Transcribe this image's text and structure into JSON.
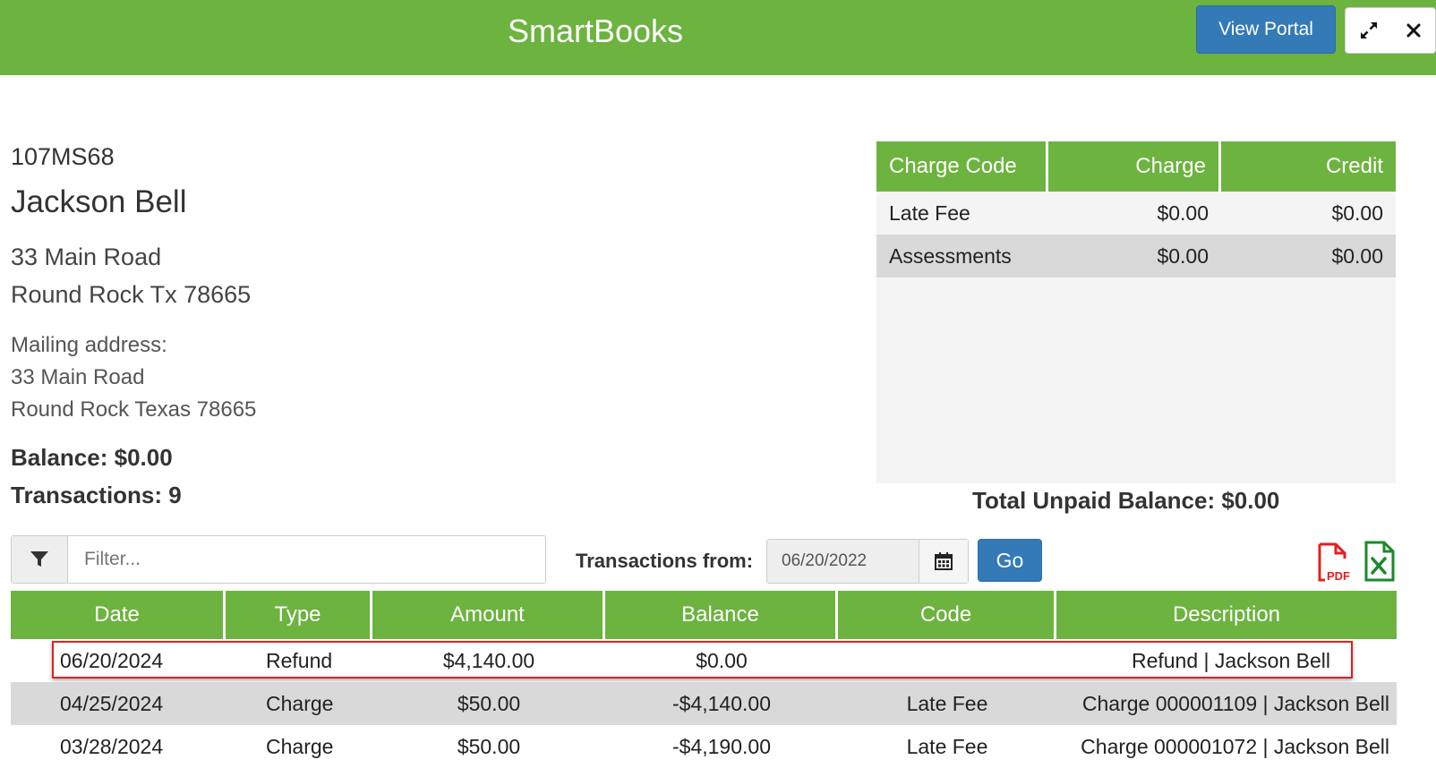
{
  "header": {
    "title": "SmartBooks",
    "view_portal_label": "View Portal",
    "expand_icon": "expand-arrows-icon",
    "close_icon": "close-icon"
  },
  "account": {
    "id": "107MS68",
    "name": "Jackson Bell",
    "address_line1": "33 Main Road",
    "address_line2": "Round Rock Tx 78665",
    "mailing_label": "Mailing address:",
    "mailing_line1": "33 Main Road",
    "mailing_line2": "Round Rock Texas 78665",
    "balance": "Balance: $0.00",
    "transactions": "Transactions: 9"
  },
  "charge_codes": {
    "headers": [
      "Charge Code",
      "Charge",
      "Credit"
    ],
    "rows": [
      {
        "code": "Late Fee",
        "charge": "$0.00",
        "credit": "$0.00"
      },
      {
        "code": "Assessments",
        "charge": "$0.00",
        "credit": "$0.00"
      }
    ],
    "total_unpaid": "Total Unpaid Balance: $0.00"
  },
  "filters": {
    "filter_placeholder": "Filter...",
    "filter_icon": "funnel-icon",
    "transactions_from_label": "Transactions from:",
    "date_value": "06/20/2022",
    "calendar_icon": "calendar-icon",
    "go_label": "Go",
    "pdf_icon": "pdf-export-icon",
    "excel_icon": "excel-export-icon"
  },
  "transactions": {
    "headers": [
      "Date",
      "Type",
      "Amount",
      "Balance",
      "Code",
      "Description"
    ],
    "rows": [
      {
        "date": "06/20/2024",
        "type": "Refund",
        "amount": "$4,140.00",
        "balance": "$0.00",
        "code": "",
        "description": "Refund | Jackson Bell"
      },
      {
        "date": "04/25/2024",
        "type": "Charge",
        "amount": "$50.00",
        "balance": "-$4,140.00",
        "code": "Late Fee",
        "description": "Charge 000001109 | Jackson Bell"
      },
      {
        "date": "03/28/2024",
        "type": "Charge",
        "amount": "$50.00",
        "balance": "-$4,190.00",
        "code": "Late Fee",
        "description": "Charge 000001072 | Jackson Bell"
      }
    ]
  },
  "colors": {
    "brand_green": "#6cb33f",
    "button_blue": "#337ab7",
    "highlight_red": "#e02020"
  }
}
